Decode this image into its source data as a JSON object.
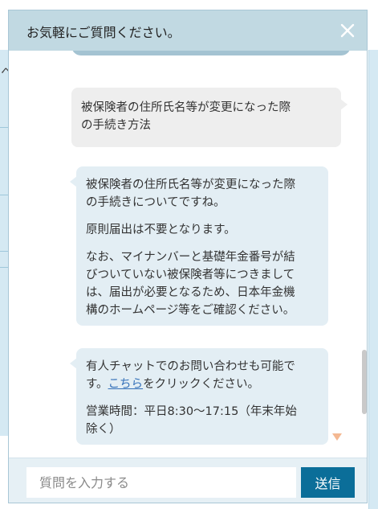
{
  "background": {
    "partial_char": "ヘ"
  },
  "header": {
    "title": "お気軽にご質問ください。",
    "close_icon": "close-icon"
  },
  "messages": {
    "user": {
      "lines": [
        "被保険者の住所氏名等が変更になった際",
        "の手続き方法"
      ]
    },
    "bot_1": {
      "paragraphs": [
        [
          "被保険者の住所氏名等が変更になった際",
          "の手続きについてですね。"
        ],
        [
          "原則届出は不要となります。"
        ],
        [
          "なお、マイナンバーと基礎年金番号が結",
          "びついていない被保険者等につきまして",
          "は、届出が必要となるため、日本年金機",
          "構のホームページ等をご確認ください。"
        ]
      ]
    },
    "bot_2": {
      "line1": "有人チャットでのお問い合わせも可能で",
      "line2_prefix": "す。",
      "link_text": "こちら",
      "line2_suffix": "をクリックください。",
      "hours_line1": "営業時間：平日8:30〜17:15（年末年始",
      "hours_line2": "除く）"
    }
  },
  "footer": {
    "input_placeholder": "質問を入力する",
    "input_value": "",
    "send_label": "送信"
  },
  "colors": {
    "header_bg": "#c1d9e2",
    "bot_bubble": "#e3eef4",
    "user_bubble": "#eeeeee",
    "send_button": "#0b6e99",
    "link": "#3571b9"
  }
}
